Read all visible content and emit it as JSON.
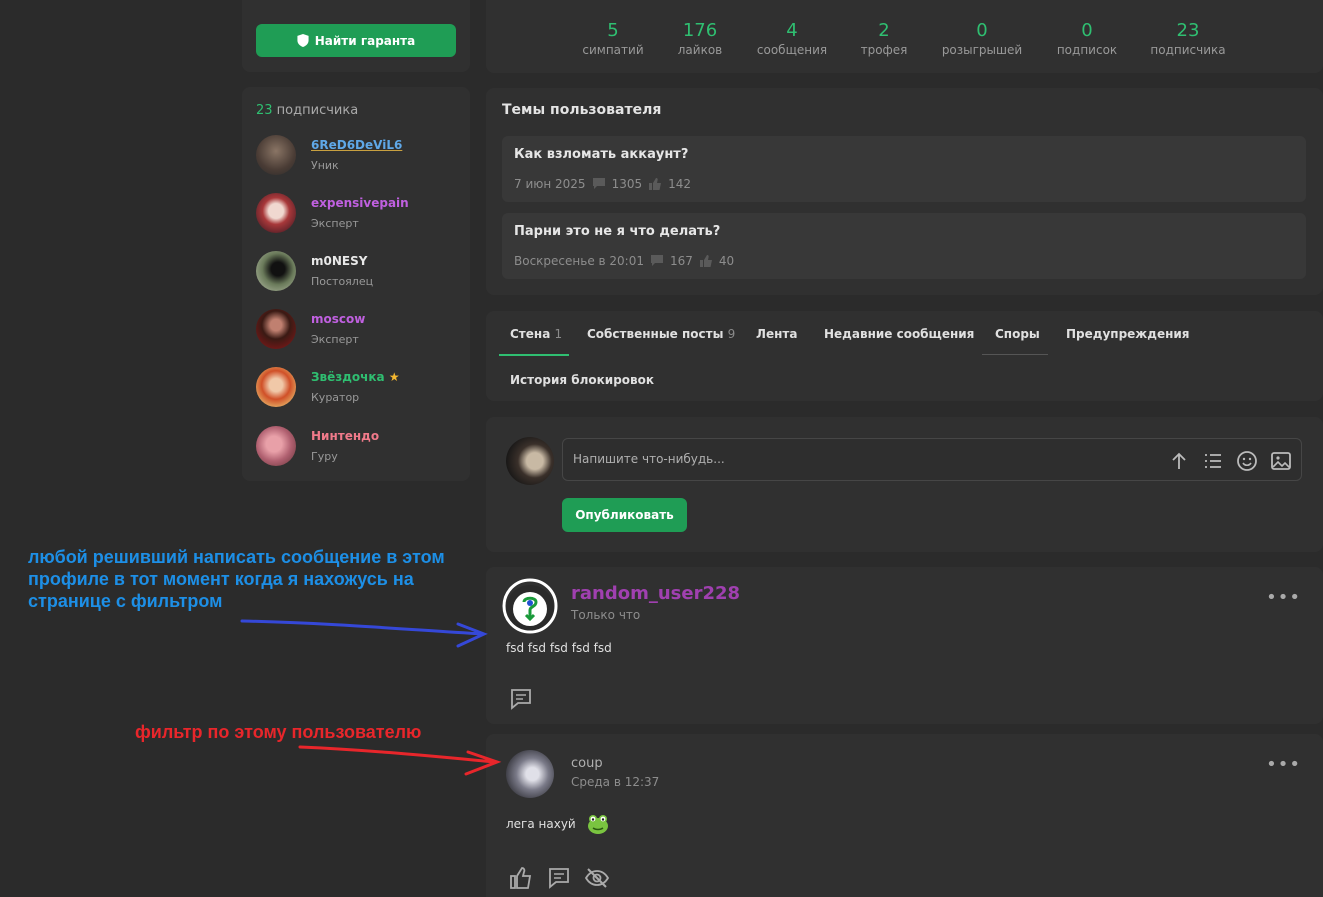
{
  "guarantor": {
    "button_label": "Найти гаранта",
    "icon": "shield-icon"
  },
  "followers": {
    "count": "23",
    "label": " подписчика",
    "items": [
      {
        "name": "6ReD6DeViL6",
        "rank": "Уник",
        "color": "#5fa8e8"
      },
      {
        "name": "expensivepain",
        "rank": "Эксперт",
        "color": "#c060e0"
      },
      {
        "name": "m0NESY",
        "rank": "Постоялец",
        "color": "#e8e8e8"
      },
      {
        "name": "moscow",
        "rank": "Эксперт",
        "color": "#c060e0"
      },
      {
        "name": "Звёздочка",
        "rank": "Куратор",
        "color": "#2fbf71"
      },
      {
        "name": "Нинтендо",
        "rank": "Гуру",
        "color": "#f07a8a"
      }
    ]
  },
  "stats": [
    {
      "value": "5",
      "label": "симпатий"
    },
    {
      "value": "176",
      "label": "лайков"
    },
    {
      "value": "4",
      "label": "сообщения"
    },
    {
      "value": "2",
      "label": "трофея"
    },
    {
      "value": "0",
      "label": "розыгрышей"
    },
    {
      "value": "0",
      "label": "подписок"
    },
    {
      "value": "23",
      "label": "подписчика"
    }
  ],
  "topics": {
    "title": "Темы пользователя",
    "items": [
      {
        "title": "Как взломать аккаунт?",
        "date": "7 июн 2025",
        "replies": "1305",
        "likes": "142"
      },
      {
        "title": "Парни это не я что делать?",
        "date": "Воскресенье в 20:01",
        "replies": "167",
        "likes": "40"
      }
    ]
  },
  "tabs": [
    {
      "label": "Стена",
      "count": "1"
    },
    {
      "label": "Собственные посты",
      "count": "9"
    },
    {
      "label": "Лента",
      "count": ""
    },
    {
      "label": "Недавние сообщения",
      "count": ""
    },
    {
      "label": "Споры",
      "count": ""
    },
    {
      "label": "Предупреждения",
      "count": ""
    },
    {
      "label": "История блокировок",
      "count": ""
    }
  ],
  "composer": {
    "placeholder": "Напишите что-нибудь...",
    "publish_label": "Опубликовать"
  },
  "posts": [
    {
      "author": "random_user228",
      "time": "Только что",
      "text": "fsd fsd fsd fsd fsd",
      "author_color": "#a040b0"
    },
    {
      "author": "coup",
      "time": "Среда в 12:37",
      "text": "лега нахуй",
      "author_color": "#b0b0b0"
    }
  ],
  "annotations": {
    "blue": "любой решивший написать сообщение в этом профиле в тот момент когда я нахожусь на странице с фильтром",
    "red": "фильтр по этому пользователю"
  },
  "colors": {
    "accent": "#2fbf71",
    "button": "#1f9d55",
    "annotation_blue": "#1d8fe6",
    "annotation_red": "#e8262b"
  }
}
